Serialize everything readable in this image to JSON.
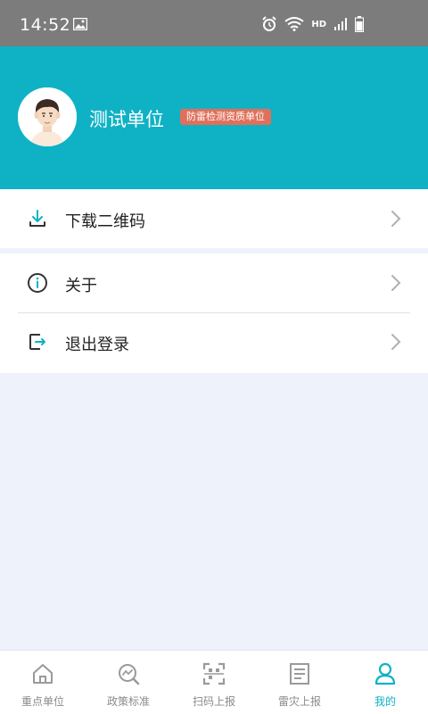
{
  "status_bar": {
    "time": "14:52",
    "network": "HD"
  },
  "profile": {
    "name": "测试单位",
    "badge": "防雷检测资质单位"
  },
  "menu": [
    {
      "label": "下载二维码",
      "icon": "download-icon"
    },
    {
      "label": "关于",
      "icon": "info-icon"
    },
    {
      "label": "退出登录",
      "icon": "logout-icon"
    }
  ],
  "tabs": [
    {
      "label": "重点单位",
      "icon": "home-icon"
    },
    {
      "label": "政策标准",
      "icon": "search-chart-icon"
    },
    {
      "label": "扫码上报",
      "icon": "scan-icon"
    },
    {
      "label": "雷灾上报",
      "icon": "document-icon"
    },
    {
      "label": "我的",
      "icon": "user-icon",
      "active": true
    }
  ],
  "colors": {
    "accent": "#0fb2c5",
    "badge": "#e0705b",
    "background": "#eef2fb"
  }
}
